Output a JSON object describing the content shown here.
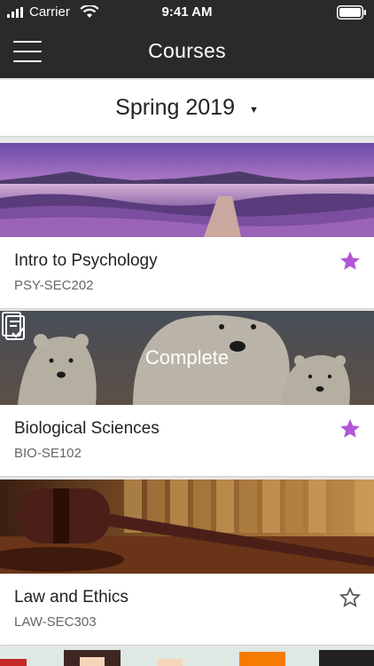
{
  "status_bar": {
    "carrier": "Carrier",
    "time": "9:41 AM"
  },
  "nav": {
    "title": "Courses"
  },
  "semester": {
    "label": "Spring 2019"
  },
  "courses": [
    {
      "title": "Intro to Psychology",
      "code": "PSY-SEC202",
      "favorite": true
    },
    {
      "title": "Biological Sciences",
      "code": "BIO-SE102",
      "favorite": true,
      "status": "Complete"
    },
    {
      "title": "Law and Ethics",
      "code": "LAW-SEC303",
      "favorite": false
    }
  ],
  "colors": {
    "header": "#2a2a2a",
    "star_filled": "#b356d6",
    "star_outline": "#555555"
  }
}
